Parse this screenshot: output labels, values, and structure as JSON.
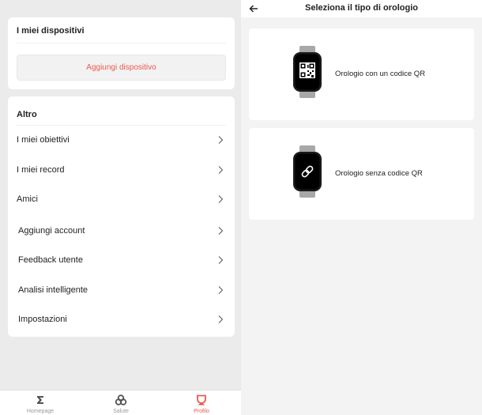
{
  "profile": {
    "devices": {
      "title": "I miei dispositivi",
      "add_button": "Aggiungi dispositivo"
    },
    "other": {
      "title": "Altro",
      "items": [
        {
          "label": "I miei obiettivi"
        },
        {
          "label": "I miei record"
        },
        {
          "label": "Amici"
        },
        {
          "label": "Aggiungi account"
        },
        {
          "label": "Feedback utente"
        },
        {
          "label": "Analisi intelligente"
        },
        {
          "label": "Impostazioni"
        }
      ]
    },
    "tabbar": {
      "tabs": [
        {
          "label": "Homepage",
          "icon": "sigma-icon",
          "active": false
        },
        {
          "label": "Salute",
          "icon": "health-icon",
          "active": false
        },
        {
          "label": "Profilo",
          "icon": "profile-icon",
          "active": true
        }
      ]
    }
  },
  "watch_type": {
    "title": "Seleziona il tipo di orologio",
    "options": [
      {
        "label": "Orologio con un codice QR",
        "icon": "qr-code-icon"
      },
      {
        "label": "Orologio senza codice QR",
        "icon": "link-icon"
      }
    ]
  },
  "colors": {
    "accent": "#e85a4f",
    "background": "#ebebeb"
  }
}
